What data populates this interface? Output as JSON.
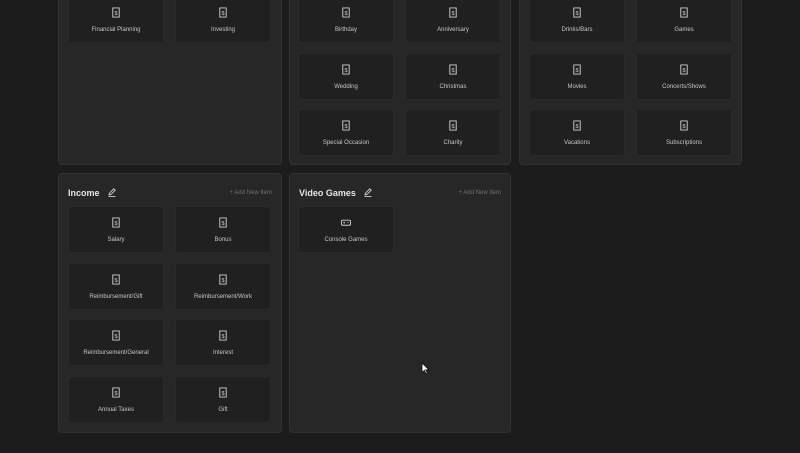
{
  "panels": {
    "top_left": {
      "tiles": [
        {
          "label": "Financial Planning",
          "icon": "receipt-icon"
        },
        {
          "label": "Investing",
          "icon": "receipt-icon"
        }
      ]
    },
    "top_mid": {
      "tiles": [
        {
          "label": "Birthday",
          "icon": "receipt-icon"
        },
        {
          "label": "Anniversary",
          "icon": "receipt-icon"
        },
        {
          "label": "Wedding",
          "icon": "receipt-icon"
        },
        {
          "label": "Christmas",
          "icon": "receipt-icon"
        },
        {
          "label": "Special Occasion",
          "icon": "receipt-icon"
        },
        {
          "label": "Charity",
          "icon": "receipt-icon"
        }
      ]
    },
    "top_right": {
      "tiles": [
        {
          "label": "Drinks/Bars",
          "icon": "receipt-icon"
        },
        {
          "label": "Games",
          "icon": "receipt-icon"
        },
        {
          "label": "Movies",
          "icon": "receipt-icon"
        },
        {
          "label": "Concerts/Shows",
          "icon": "receipt-icon"
        },
        {
          "label": "Vacations",
          "icon": "receipt-icon"
        },
        {
          "label": "Subscriptions",
          "icon": "receipt-icon"
        }
      ]
    },
    "income": {
      "title": "Income",
      "add_label": "+ Add New Item",
      "tiles": [
        {
          "label": "Salary",
          "icon": "receipt-icon"
        },
        {
          "label": "Bonus",
          "icon": "receipt-icon"
        },
        {
          "label": "Reimbursement/Gift",
          "icon": "receipt-icon"
        },
        {
          "label": "Reimbursement/Work",
          "icon": "receipt-icon"
        },
        {
          "label": "Reimbursement/General",
          "icon": "receipt-icon"
        },
        {
          "label": "Interest",
          "icon": "receipt-icon"
        },
        {
          "label": "Annual Taxes",
          "icon": "receipt-icon"
        },
        {
          "label": "Gift",
          "icon": "receipt-icon"
        }
      ]
    },
    "video_games": {
      "title": "Video Games",
      "add_label": "+ Add New Item",
      "tiles": [
        {
          "label": "Console Games",
          "icon": "gamepad-icon"
        }
      ]
    }
  },
  "colors": {
    "background": "#1c1c1c",
    "panel": "#272727",
    "tile": "#202020",
    "text": "#c6c6c6",
    "muted": "#6f6f6f"
  }
}
